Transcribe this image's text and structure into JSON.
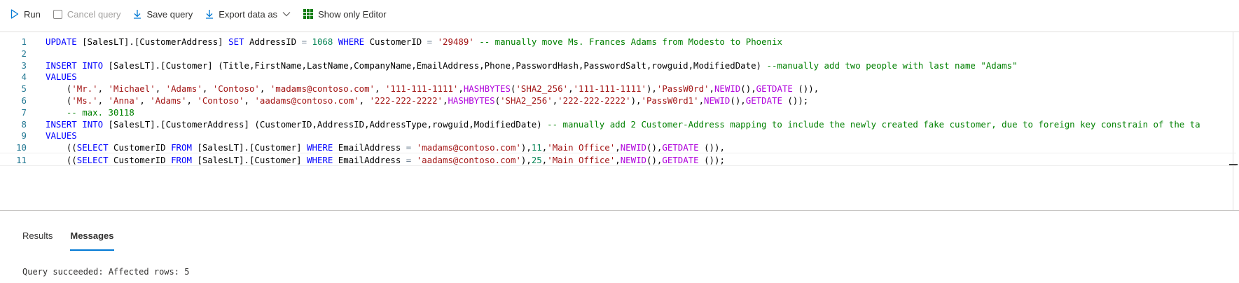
{
  "toolbar": {
    "run_label": "Run",
    "cancel_label": "Cancel query",
    "save_label": "Save query",
    "export_label": "Export data as",
    "show_editor_label": "Show only Editor"
  },
  "colors": {
    "accent": "#0078d4",
    "keyword": "#0000ff",
    "string": "#a31515",
    "function": "#af00db",
    "comment": "#008000",
    "number": "#098658",
    "line_number": "#237893"
  },
  "icons": {
    "run": "play-icon",
    "cancel": "checkbox-icon",
    "save": "download-arrow-icon",
    "export": "download-arrow-icon",
    "export_menu": "chevron-down-icon",
    "editor": "grid-icon"
  },
  "editor": {
    "current_line": 11,
    "lines": [
      {
        "n": "1",
        "tokens": [
          {
            "t": "kw",
            "v": "UPDATE"
          },
          {
            "t": "",
            "v": " [SalesLT].[CustomerAddress] "
          },
          {
            "t": "kw",
            "v": "SET"
          },
          {
            "t": "",
            "v": " AddressID "
          },
          {
            "t": "op",
            "v": "="
          },
          {
            "t": "",
            "v": " "
          },
          {
            "t": "num",
            "v": "1068"
          },
          {
            "t": "",
            "v": " "
          },
          {
            "t": "kw",
            "v": "WHERE"
          },
          {
            "t": "",
            "v": " CustomerID "
          },
          {
            "t": "op",
            "v": "="
          },
          {
            "t": "",
            "v": " "
          },
          {
            "t": "str",
            "v": "'29489'"
          },
          {
            "t": "",
            "v": " "
          },
          {
            "t": "cm",
            "v": "-- manually move Ms. Frances Adams from Modesto to Phoenix"
          }
        ]
      },
      {
        "n": "2",
        "tokens": []
      },
      {
        "n": "3",
        "tokens": [
          {
            "t": "kw",
            "v": "INSERT"
          },
          {
            "t": "",
            "v": " "
          },
          {
            "t": "kw",
            "v": "INTO"
          },
          {
            "t": "",
            "v": " [SalesLT].[Customer] (Title,FirstName,LastName,CompanyName,EmailAddress,Phone,PasswordHash,PasswordSalt,rowguid,ModifiedDate) "
          },
          {
            "t": "cm",
            "v": "--manually add two people with last name \"Adams\""
          }
        ]
      },
      {
        "n": "4",
        "tokens": [
          {
            "t": "kw",
            "v": "VALUES"
          }
        ]
      },
      {
        "n": "5",
        "tokens": [
          {
            "t": "",
            "v": "    ("
          },
          {
            "t": "str",
            "v": "'Mr.'"
          },
          {
            "t": "",
            "v": ", "
          },
          {
            "t": "str",
            "v": "'Michael'"
          },
          {
            "t": "",
            "v": ", "
          },
          {
            "t": "str",
            "v": "'Adams'"
          },
          {
            "t": "",
            "v": ", "
          },
          {
            "t": "str",
            "v": "'Contoso'"
          },
          {
            "t": "",
            "v": ", "
          },
          {
            "t": "str",
            "v": "'madams@contoso.com'"
          },
          {
            "t": "",
            "v": ", "
          },
          {
            "t": "str",
            "v": "'111-111-1111'"
          },
          {
            "t": "",
            "v": ","
          },
          {
            "t": "fn",
            "v": "HASHBYTES"
          },
          {
            "t": "",
            "v": "("
          },
          {
            "t": "str",
            "v": "'SHA2_256'"
          },
          {
            "t": "",
            "v": ","
          },
          {
            "t": "str",
            "v": "'111-111-1111'"
          },
          {
            "t": "",
            "v": "),"
          },
          {
            "t": "str",
            "v": "'PassW0rd'"
          },
          {
            "t": "",
            "v": ","
          },
          {
            "t": "fn",
            "v": "NEWID"
          },
          {
            "t": "",
            "v": "(),"
          },
          {
            "t": "fn",
            "v": "GETDATE"
          },
          {
            "t": "",
            "v": " ()),"
          }
        ]
      },
      {
        "n": "6",
        "tokens": [
          {
            "t": "",
            "v": "    ("
          },
          {
            "t": "str",
            "v": "'Ms.'"
          },
          {
            "t": "",
            "v": ", "
          },
          {
            "t": "str",
            "v": "'Anna'"
          },
          {
            "t": "",
            "v": ", "
          },
          {
            "t": "str",
            "v": "'Adams'"
          },
          {
            "t": "",
            "v": ", "
          },
          {
            "t": "str",
            "v": "'Contoso'"
          },
          {
            "t": "",
            "v": ", "
          },
          {
            "t": "str",
            "v": "'aadams@contoso.com'"
          },
          {
            "t": "",
            "v": ", "
          },
          {
            "t": "str",
            "v": "'222-222-2222'"
          },
          {
            "t": "",
            "v": ","
          },
          {
            "t": "fn",
            "v": "HASHBYTES"
          },
          {
            "t": "",
            "v": "("
          },
          {
            "t": "str",
            "v": "'SHA2_256'"
          },
          {
            "t": "",
            "v": ","
          },
          {
            "t": "str",
            "v": "'222-222-2222'"
          },
          {
            "t": "",
            "v": "),"
          },
          {
            "t": "str",
            "v": "'PassW0rd1'"
          },
          {
            "t": "",
            "v": ","
          },
          {
            "t": "fn",
            "v": "NEWID"
          },
          {
            "t": "",
            "v": "(),"
          },
          {
            "t": "fn",
            "v": "GETDATE"
          },
          {
            "t": "",
            "v": " ());"
          }
        ]
      },
      {
        "n": "7",
        "tokens": [
          {
            "t": "",
            "v": "    "
          },
          {
            "t": "cm",
            "v": "-- max. 30118"
          }
        ]
      },
      {
        "n": "8",
        "tokens": [
          {
            "t": "kw",
            "v": "INSERT"
          },
          {
            "t": "",
            "v": " "
          },
          {
            "t": "kw",
            "v": "INTO"
          },
          {
            "t": "",
            "v": " [SalesLT].[CustomerAddress] (CustomerID,AddressID,AddressType,rowguid,ModifiedDate) "
          },
          {
            "t": "cm",
            "v": "-- manually add 2 Customer-Address mapping to include the newly created fake customer, due to foreign key constrain of the ta"
          }
        ]
      },
      {
        "n": "9",
        "tokens": [
          {
            "t": "kw",
            "v": "VALUES"
          }
        ]
      },
      {
        "n": "10",
        "tokens": [
          {
            "t": "",
            "v": "    (("
          },
          {
            "t": "kw",
            "v": "SELECT"
          },
          {
            "t": "",
            "v": " CustomerID "
          },
          {
            "t": "kw",
            "v": "FROM"
          },
          {
            "t": "",
            "v": " [SalesLT].[Customer] "
          },
          {
            "t": "kw",
            "v": "WHERE"
          },
          {
            "t": "",
            "v": " EmailAddress "
          },
          {
            "t": "op",
            "v": "="
          },
          {
            "t": "",
            "v": " "
          },
          {
            "t": "str",
            "v": "'madams@contoso.com'"
          },
          {
            "t": "",
            "v": "),"
          },
          {
            "t": "num",
            "v": "11"
          },
          {
            "t": "",
            "v": ","
          },
          {
            "t": "str",
            "v": "'Main Office'"
          },
          {
            "t": "",
            "v": ","
          },
          {
            "t": "fn",
            "v": "NEWID"
          },
          {
            "t": "",
            "v": "(),"
          },
          {
            "t": "fn",
            "v": "GETDATE"
          },
          {
            "t": "",
            "v": " ()),"
          }
        ]
      },
      {
        "n": "11",
        "tokens": [
          {
            "t": "",
            "v": "    (("
          },
          {
            "t": "kw",
            "v": "SELECT"
          },
          {
            "t": "",
            "v": " CustomerID "
          },
          {
            "t": "kw",
            "v": "FROM"
          },
          {
            "t": "",
            "v": " [SalesLT].[Customer] "
          },
          {
            "t": "kw",
            "v": "WHERE"
          },
          {
            "t": "",
            "v": " EmailAddress "
          },
          {
            "t": "op",
            "v": "="
          },
          {
            "t": "",
            "v": " "
          },
          {
            "t": "str",
            "v": "'aadams@contoso.com'"
          },
          {
            "t": "",
            "v": "),"
          },
          {
            "t": "num",
            "v": "25"
          },
          {
            "t": "",
            "v": ","
          },
          {
            "t": "str",
            "v": "'Main Office'"
          },
          {
            "t": "",
            "v": ","
          },
          {
            "t": "fn",
            "v": "NEWID"
          },
          {
            "t": "",
            "v": "(),"
          },
          {
            "t": "fn",
            "v": "GETDATE"
          },
          {
            "t": "",
            "v": " ());"
          }
        ]
      }
    ]
  },
  "results": {
    "tabs": [
      {
        "label": "Results",
        "active": false
      },
      {
        "label": "Messages",
        "active": true
      }
    ],
    "message": "Query succeeded: Affected rows: 5"
  }
}
